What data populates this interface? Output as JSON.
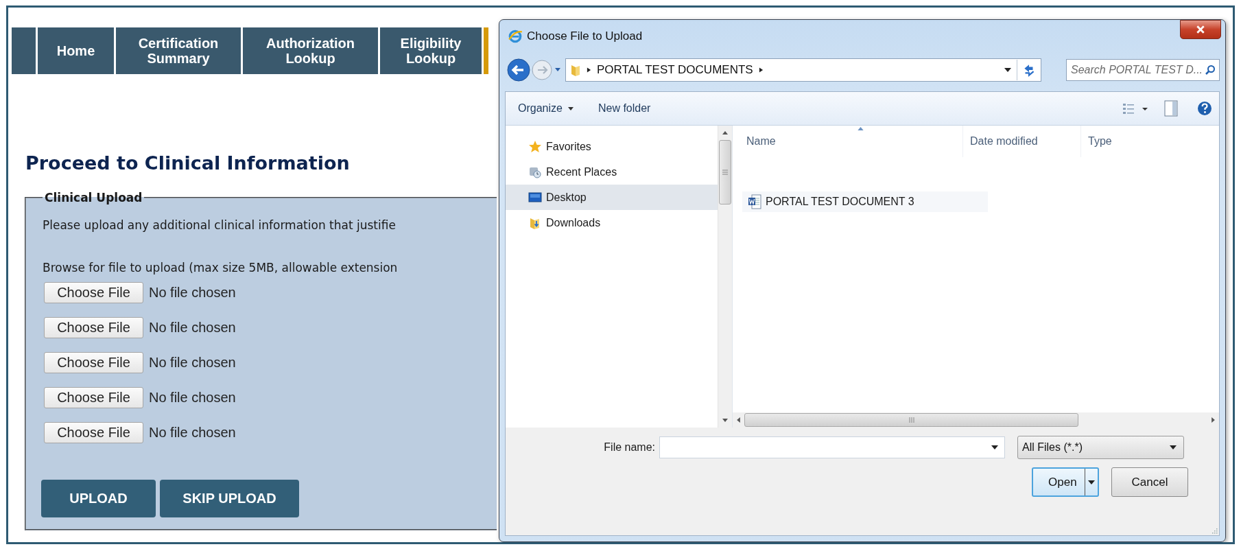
{
  "nav_tabs": [
    {
      "label": "Home"
    },
    {
      "label": "Certification Summary"
    },
    {
      "label": "Authorization Lookup"
    },
    {
      "label": "Eligibility Lookup"
    }
  ],
  "page": {
    "heading": "Proceed to Clinical Information",
    "fieldset": {
      "legend": "Clinical Upload",
      "instructions": [
        "Please upload any additional clinical information that justifie",
        "Browse for file to upload (max size 5MB, allowable extension"
      ],
      "file_inputs": [
        {
          "button": "Choose File",
          "status": "No file chosen"
        },
        {
          "button": "Choose File",
          "status": "No file chosen"
        },
        {
          "button": "Choose File",
          "status": "No file chosen"
        },
        {
          "button": "Choose File",
          "status": "No file chosen"
        },
        {
          "button": "Choose File",
          "status": "No file chosen"
        }
      ],
      "buttons": [
        "UPLOAD",
        "SKIP UPLOAD"
      ]
    }
  },
  "dialog": {
    "title": "Choose File to Upload",
    "address": {
      "path": "PORTAL TEST DOCUMENTS"
    },
    "search": {
      "placeholder": "Search PORTAL TEST D..."
    },
    "toolbar": [
      {
        "label": "Organize",
        "dropdown": true
      },
      {
        "label": "New folder",
        "dropdown": false
      }
    ],
    "nav_items": [
      {
        "label": "Favorites",
        "kind": "favorites",
        "selected": false
      },
      {
        "label": "Recent Places",
        "kind": "recent",
        "selected": false
      },
      {
        "label": "Desktop",
        "kind": "desktop",
        "selected": true
      },
      {
        "label": "Downloads",
        "kind": "downloads",
        "selected": false
      }
    ],
    "columns": [
      "Name",
      "Date modified",
      "Type"
    ],
    "files": [
      {
        "name": "PORTAL TEST DOCUMENT 3",
        "kind": "word"
      }
    ],
    "file_name_label": "File name:",
    "file_type": "All Files (*.*)",
    "buttons": [
      "Open",
      "Cancel"
    ]
  }
}
